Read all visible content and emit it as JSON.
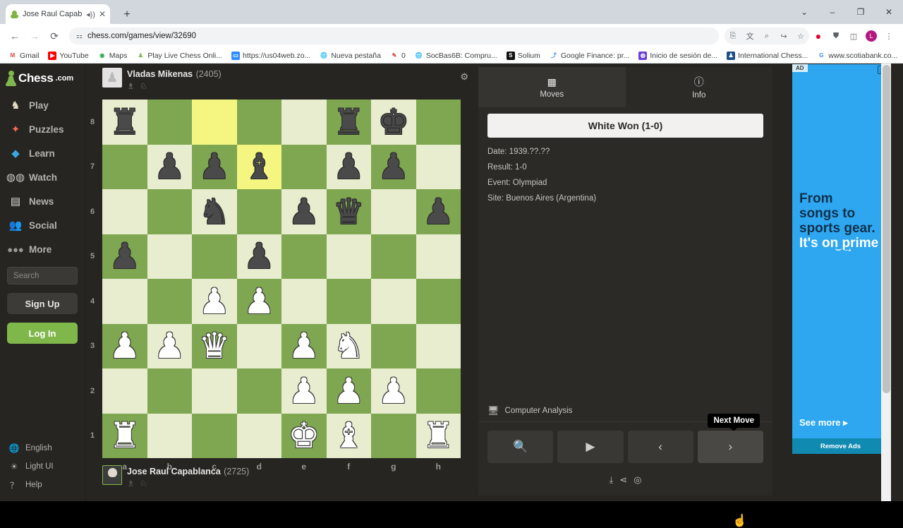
{
  "browser": {
    "tab": {
      "title": "Jose Raul Capablanca - Vla",
      "favicon": "chess-pawn-icon",
      "audio_icon": "speaker-icon",
      "close_icon": "close-icon"
    },
    "newtab_label": "+",
    "window_controls": [
      "chevron-down-icon",
      "minimize-icon",
      "maximize-icon",
      "close-icon"
    ],
    "nav": {
      "back": "back-arrow-icon",
      "forward": "forward-arrow-icon",
      "reload": "reload-icon"
    },
    "omnibox": {
      "url": "chess.com/games/view/32690",
      "site_settings_icon": "tune-icon"
    },
    "toolbar_icons": [
      "install-icon",
      "translate-icon",
      "zoom-icon",
      "share-icon",
      "bookmark-star-icon",
      "opera-icon",
      "extension-icon",
      "sidepanel-icon",
      "profile-avatar",
      "kebab-menu-icon"
    ],
    "profile_initial": "L",
    "bookmarks": [
      {
        "label": "Gmail",
        "icon": "gmail-icon",
        "color": "#ea4335"
      },
      {
        "label": "YouTube",
        "icon": "youtube-icon",
        "color": "#ff0000"
      },
      {
        "label": "Maps",
        "icon": "maps-pin-icon",
        "color": "#34a853"
      },
      {
        "label": "Play Live Chess Onli...",
        "icon": "chess-pawn-icon",
        "color": "#81b64c"
      },
      {
        "label": "https://us04web.zo...",
        "icon": "zoom-app-icon",
        "color": "#2d8cff"
      },
      {
        "label": "Nueva pestaña",
        "icon": "globe-icon",
        "color": "#5f6368"
      },
      {
        "label": "0",
        "icon": "bookmark-icon",
        "color": "#e53935"
      },
      {
        "label": "SocBas6B: Compru...",
        "icon": "globe-icon",
        "color": "#5f6368"
      },
      {
        "label": "Solium",
        "icon": "solium-icon",
        "color": "#111111"
      },
      {
        "label": "Google Finance: pr...",
        "icon": "finance-icon",
        "color": "#4285f4"
      },
      {
        "label": "Inicio de sesión de...",
        "icon": "login-icon",
        "color": "#6a3fd6"
      },
      {
        "label": "International Chess...",
        "icon": "chess-federation-icon",
        "color": "#1a4f8a"
      },
      {
        "label": "www.scotiabank.co...",
        "icon": "google-icon",
        "color": "#4285f4"
      }
    ]
  },
  "sidebar": {
    "logo": {
      "name": "Chess",
      "suffix": ".com",
      "icon": "chess-pawn-icon"
    },
    "items": [
      {
        "label": "Play",
        "icon": "knight-icon"
      },
      {
        "label": "Puzzles",
        "icon": "puzzle-piece-icon"
      },
      {
        "label": "Learn",
        "icon": "graduation-cap-icon"
      },
      {
        "label": "Watch",
        "icon": "binoculars-icon"
      },
      {
        "label": "News",
        "icon": "newspaper-icon"
      },
      {
        "label": "Social",
        "icon": "people-icon"
      },
      {
        "label": "More",
        "icon": "ellipsis-icon"
      }
    ],
    "search_placeholder": "Search",
    "sign_up_label": "Sign Up",
    "log_in_label": "Log In",
    "footer": [
      {
        "label": "English",
        "icon": "globe-icon"
      },
      {
        "label": "Light UI",
        "icon": "brightness-icon"
      },
      {
        "label": "Help",
        "icon": "question-circle-icon"
      }
    ]
  },
  "game": {
    "top_player": {
      "name": "Vladas Mikenas",
      "rating": "(2405)",
      "captured": "♗ ♘",
      "avatar": "white-pawn-avatar"
    },
    "bottom_player": {
      "name": "Jose Raul Capablanca",
      "rating": "(2725)",
      "captured": "♗ ♘",
      "avatar": "capablanca-photo"
    },
    "settings_icon": "gear-icon",
    "files": [
      "a",
      "b",
      "c",
      "d",
      "e",
      "f",
      "g",
      "h"
    ],
    "ranks": [
      "8",
      "7",
      "6",
      "5",
      "4",
      "3",
      "2",
      "1"
    ],
    "highlighted_squares": [
      "c8",
      "d7"
    ],
    "position": [
      [
        "r",
        "",
        "",
        "",
        "",
        "r",
        "k",
        ""
      ],
      [
        "",
        "p",
        "p",
        "b",
        "",
        "p",
        "p",
        ""
      ],
      [
        "",
        "",
        "n",
        "",
        "p",
        "q",
        "",
        "p"
      ],
      [
        "p",
        "",
        "",
        "p",
        "",
        "",
        "",
        ""
      ],
      [
        "",
        "",
        "P",
        "P",
        "",
        "",
        "",
        ""
      ],
      [
        "P",
        "P",
        "Q",
        "",
        "P",
        "N",
        "",
        ""
      ],
      [
        "",
        "",
        "",
        "",
        "P",
        "P",
        "P",
        ""
      ],
      [
        "R",
        "",
        "",
        "",
        "K",
        "B",
        "",
        "R"
      ]
    ],
    "glyphs": {
      "r": "♜",
      "n": "♞",
      "b": "♝",
      "q": "♛",
      "k": "♚",
      "p": "♟",
      "R": "♜",
      "N": "♞",
      "B": "♝",
      "Q": "♛",
      "K": "♚",
      "P": "♟"
    }
  },
  "panel": {
    "tabs": [
      {
        "label": "Moves",
        "icon": "checkerboard-icon",
        "active": true
      },
      {
        "label": "Info",
        "icon": "info-circle-icon",
        "active": false
      }
    ],
    "result_banner": "White Won (1-0)",
    "meta": [
      "Date: 1939.??.??",
      "Result: 1-0",
      "Event: Olympiad",
      "Site: Buenos Aires (Argentina)"
    ],
    "analysis": {
      "label": "Computer Analysis",
      "icon": "computer-search-icon"
    },
    "controls": [
      {
        "name": "analysis-zoom-button",
        "icon": "magnifier-plus-icon"
      },
      {
        "name": "play-button",
        "icon": "play-icon"
      },
      {
        "name": "previous-move-button",
        "icon": "chevron-left-icon"
      },
      {
        "name": "next-move-button",
        "icon": "chevron-right-icon"
      }
    ],
    "tooltip": "Next Move",
    "share_icons": [
      "download-icon",
      "share-icon",
      "target-icon"
    ]
  },
  "ad": {
    "badge": "AD",
    "adchoices_icon": "adchoices-icon",
    "line1": "From",
    "line2": "songs to",
    "line3": "sports gear.",
    "line4": "It's on prime",
    "smile_icon": "amazon-smile-icon",
    "see_more": "See more ▸",
    "remove_ads": "Remove Ads",
    "bg_color": "#2ea7f0"
  },
  "colors": {
    "accent_green": "#81b64c",
    "board_light": "#e8edcf",
    "board_dark": "#7fa650",
    "highlight_light": "#f5f682",
    "highlight_dark": "#b9ca42",
    "page_bg": "#262522"
  }
}
